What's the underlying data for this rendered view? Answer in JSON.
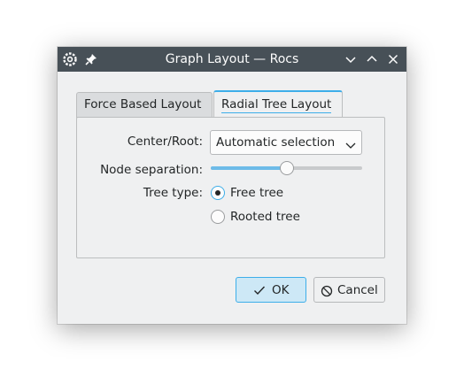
{
  "window": {
    "title": "Graph Layout — Rocs",
    "titlebar_icons": [
      "app-gear-icon",
      "pin-icon"
    ],
    "controls": [
      "minimize-icon",
      "maximize-icon",
      "close-icon"
    ],
    "colors": {
      "titlebar": "#475057",
      "accent": "#3daee9",
      "background": "#eff0f1"
    }
  },
  "tabs": [
    {
      "label": "Force Based Layout",
      "active": false
    },
    {
      "label": "Radial Tree Layout",
      "active": true
    }
  ],
  "form": {
    "center_root_label": "Center/Root:",
    "center_root_value": "Automatic selection",
    "node_separation_label": "Node separation:",
    "node_separation_level": 0.5,
    "tree_type_label": "Tree type:",
    "tree_types": [
      {
        "label": "Free tree",
        "selected": true
      },
      {
        "label": "Rooted tree",
        "selected": false
      }
    ]
  },
  "buttons": {
    "ok_label": "OK",
    "ok_icon": "checkmark-icon",
    "cancel_label": "Cancel",
    "cancel_icon": "cancel-icon"
  }
}
